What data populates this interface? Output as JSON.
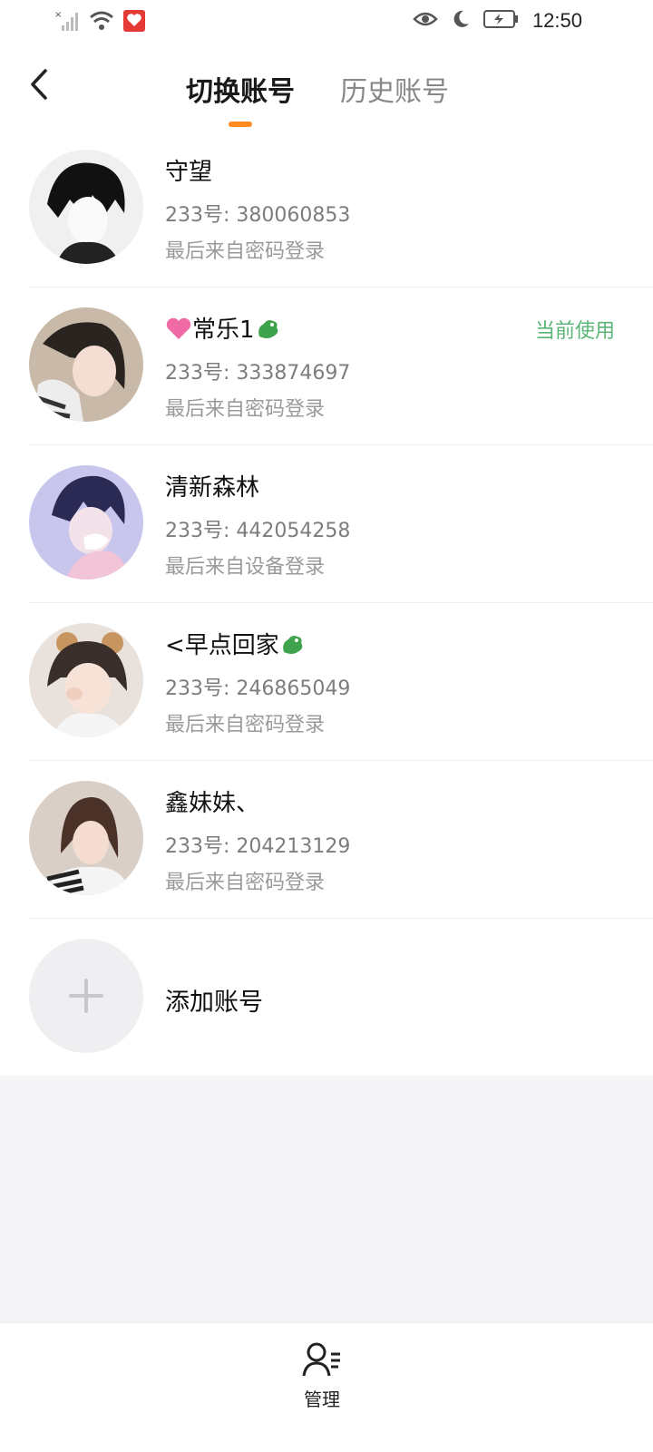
{
  "statusbar": {
    "time": "12:50"
  },
  "header": {
    "tabs": [
      {
        "label": "切换账号",
        "active": true
      },
      {
        "label": "历史账号",
        "active": false
      }
    ]
  },
  "accounts": [
    {
      "name": "守望",
      "uid": "233号: 380060853",
      "source": "最后来自密码登录",
      "current": ""
    },
    {
      "name": "常乐1",
      "uid": "233号: 333874697",
      "source": "最后来自密码登录",
      "current": "当前使用"
    },
    {
      "name": "清新森林",
      "uid": "233号: 442054258",
      "source": "最后来自设备登录",
      "current": ""
    },
    {
      "name": "<早点回家",
      "uid": "233号: 246865049",
      "source": "最后来自密码登录",
      "current": ""
    },
    {
      "name": "鑫妹妹、",
      "uid": "233号: 204213129",
      "source": "最后来自密码登录",
      "current": ""
    }
  ],
  "add_account": {
    "label": "添加账号"
  },
  "bottom": {
    "manage_label": "管理"
  },
  "colors": {
    "accent": "#ff8a1f",
    "current": "#5bb577"
  },
  "icons": [
    "signal-icon",
    "wifi-icon",
    "app-notification-icon",
    "eye-icon",
    "moon-icon",
    "battery-charging-icon",
    "back-arrow-icon",
    "heart-emoji-icon",
    "dragon-emoji-icon",
    "plus-icon",
    "user-manage-icon"
  ]
}
